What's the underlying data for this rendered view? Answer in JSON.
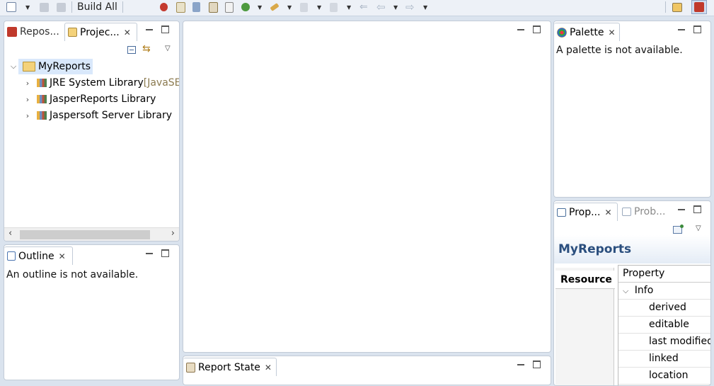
{
  "toolbar": {
    "build_all": "Build All"
  },
  "left_top": {
    "tabs": [
      {
        "label": "Repos...",
        "icon": "repository-icon"
      },
      {
        "label": "Projec...",
        "icon": "project-explorer-icon"
      }
    ],
    "tree": {
      "root": "MyReports",
      "children": [
        {
          "label": "JRE System Library",
          "suffix": " [JavaSE-"
        },
        {
          "label": "JasperReports Library",
          "suffix": ""
        },
        {
          "label": "Jaspersoft Server Library",
          "suffix": ""
        }
      ]
    }
  },
  "outline": {
    "tab": "Outline",
    "message": "An outline is not available."
  },
  "palette": {
    "tab": "Palette",
    "message": "A palette is not available."
  },
  "report_state": {
    "tab": "Report State"
  },
  "properties": {
    "tabs": [
      {
        "label": "Prop..."
      },
      {
        "label": "Prob..."
      }
    ],
    "title": "MyReports",
    "side_tab": "Resource",
    "column_header": "Property",
    "group": "Info",
    "rows": [
      "derived",
      "editable",
      "last modified",
      "linked",
      "location"
    ]
  },
  "colors": {
    "accent_title": "#2b4f7e",
    "selection": "#d9e8fb",
    "library_suffix": "#8b7a4f"
  }
}
